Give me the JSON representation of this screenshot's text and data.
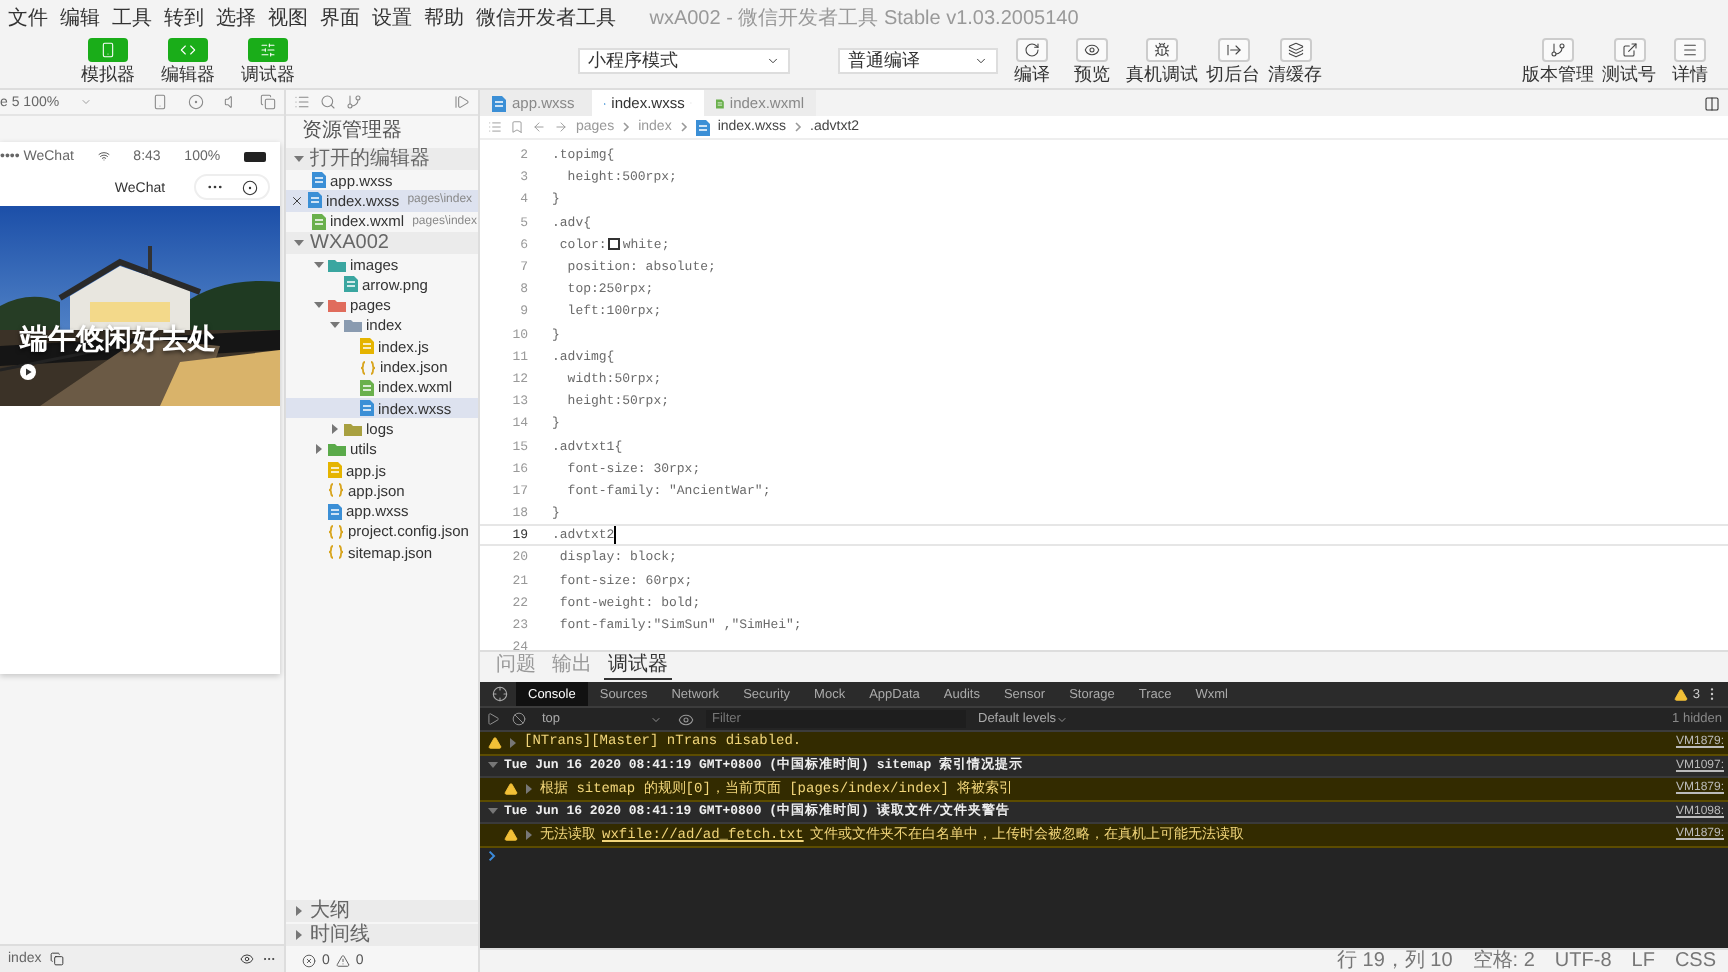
{
  "window": {
    "title": "wxA002 - 微信开发者工具 Stable v1.03.2005140"
  },
  "menu": [
    "文件",
    "编辑",
    "工具",
    "转到",
    "选择",
    "视图",
    "界面",
    "设置",
    "帮助",
    "微信开发者工具"
  ],
  "toolbar": {
    "views": [
      {
        "label": "模拟器",
        "kind": "phone",
        "on": true
      },
      {
        "label": "编辑器",
        "kind": "code",
        "on": true
      },
      {
        "label": "调试器",
        "kind": "debug",
        "on": true
      }
    ],
    "mode": "小程序模式",
    "compile": "普通编译",
    "actions": [
      {
        "label": "编译",
        "kind": "refresh"
      },
      {
        "label": "预览",
        "kind": "eye"
      },
      {
        "label": "真机调试",
        "kind": "bug"
      },
      {
        "label": "切后台",
        "kind": "switch"
      },
      {
        "label": "清缓存",
        "kind": "layers"
      }
    ],
    "right": [
      {
        "label": "版本管理",
        "kind": "branch"
      },
      {
        "label": "测试号",
        "kind": "external"
      },
      {
        "label": "详情",
        "kind": "menu"
      }
    ]
  },
  "simulator": {
    "zoom": "e 5 100%",
    "carrier": "•••• WeChat",
    "time": "8:43",
    "battery": "100%",
    "nav_title": "WeChat",
    "banner": {
      "kind": "picture",
      "title": "端午悠闲好去处"
    },
    "page_path": "index"
  },
  "explorer": {
    "title": "资源管理器",
    "open_editors": {
      "label": "打开的编辑器",
      "expanded": true,
      "items": [
        {
          "name": "app.wxss",
          "kind": "css",
          "selected": false
        },
        {
          "name": "index.wxss",
          "path": "pages\\index",
          "kind": "css",
          "selected": true
        },
        {
          "name": "index.wxml",
          "path": "pages\\index",
          "kind": "wxml",
          "selected": false
        }
      ]
    },
    "project": {
      "label": "WXA002",
      "expanded": true
    },
    "tree": [
      {
        "name": "images",
        "kind": "folder",
        "color": "#3aa6a0",
        "expanded": true,
        "selected": false,
        "children": [
          {
            "name": "arrow.png",
            "selected": false
          }
        ]
      },
      {
        "name": "pages",
        "kind": "folder",
        "color": "#e06c5c",
        "expanded": true,
        "selected": false,
        "children": [
          {
            "name": "index",
            "kind": "folder",
            "color": "#8a9bb0",
            "expanded": true,
            "selected": false,
            "children": [
              {
                "name": "index.js",
                "kind": "js",
                "selected": false
              },
              {
                "name": "index.json",
                "kind": "json",
                "selected": false
              },
              {
                "name": "index.wxml",
                "kind": "wxml",
                "selected": false
              },
              {
                "name": "index.wxss",
                "kind": "css",
                "selected": true
              }
            ]
          },
          {
            "name": "logs",
            "kind": "folder",
            "color": "#a8a040",
            "expanded": false,
            "selected": false
          }
        ]
      },
      {
        "name": "utils",
        "kind": "folder",
        "color": "#5aaa4a",
        "expanded": false,
        "selected": false
      },
      {
        "name": "app.js",
        "kind": "js",
        "selected": false
      },
      {
        "name": "app.json",
        "kind": "json",
        "selected": false
      },
      {
        "name": "app.wxss",
        "kind": "css",
        "selected": false
      },
      {
        "name": "project.config.json",
        "kind": "json",
        "selected": false
      },
      {
        "name": "sitemap.json",
        "kind": "json",
        "selected": false
      }
    ],
    "sections": [
      {
        "label": "大纲",
        "expanded": false
      },
      {
        "label": "时间线",
        "expanded": false
      }
    ],
    "problems": {
      "errors": "0",
      "warnings": "0"
    }
  },
  "editor": {
    "tabs": [
      {
        "name": "app.wxss",
        "kind": "css",
        "selected": false
      },
      {
        "name": "index.wxss",
        "kind": "css",
        "selected": true
      },
      {
        "name": "index.wxml",
        "kind": "wxml",
        "selected": false
      }
    ],
    "breadcrumb": [
      "pages",
      "index",
      "index.wxss",
      ".advtxt2"
    ],
    "lines": [
      {
        "number": "2",
        "text": ".topimg{",
        "current": false
      },
      {
        "number": "3",
        "text": "  height:500rpx;",
        "current": false
      },
      {
        "number": "4",
        "text": "}",
        "current": false
      },
      {
        "number": "5",
        "text": ".adv{",
        "current": false
      },
      {
        "number": "6",
        "text": " color:",
        "color": "#ffffff",
        "after": "white;",
        "current": false
      },
      {
        "number": "7",
        "text": "  position: absolute;",
        "current": false
      },
      {
        "number": "8",
        "text": "  top:250rpx;",
        "current": false
      },
      {
        "number": "9",
        "text": "  left:100rpx;",
        "current": false
      },
      {
        "number": "10",
        "text": "}",
        "current": false
      },
      {
        "number": "11",
        "text": ".advimg{",
        "current": false
      },
      {
        "number": "12",
        "text": "  width:50rpx;",
        "current": false
      },
      {
        "number": "13",
        "text": "  height:50rpx;",
        "current": false
      },
      {
        "number": "14",
        "text": "}",
        "current": false
      },
      {
        "number": "15",
        "text": ".advtxt1{",
        "current": false
      },
      {
        "number": "16",
        "text": "  font-size: 30rpx;",
        "current": false
      },
      {
        "number": "17",
        "text": "  font-family: \"AncientWar\";",
        "current": false
      },
      {
        "number": "18",
        "text": "}",
        "current": false
      },
      {
        "number": "19",
        "text": ".advtxt2",
        "current": true
      },
      {
        "number": "20",
        "text": " display: block;",
        "current": false
      },
      {
        "number": "21",
        "text": " font-size: 60rpx;",
        "current": false
      },
      {
        "number": "22",
        "text": " font-weight: bold;",
        "current": false
      },
      {
        "number": "23",
        "text": " font-family:\"SimSun\" ,\"SimHei\";",
        "current": false
      },
      {
        "number": "24",
        "current": false
      }
    ]
  },
  "panel": {
    "tabs": [
      {
        "label": "问题",
        "selected": false
      },
      {
        "label": "输出",
        "selected": false
      },
      {
        "label": "调试器",
        "selected": true
      }
    ],
    "devtools": {
      "tabs": [
        {
          "label": "Console",
          "selected": true
        },
        {
          "label": "Sources",
          "selected": false
        },
        {
          "label": "Network",
          "selected": false
        },
        {
          "label": "Security",
          "selected": false
        },
        {
          "label": "Mock",
          "selected": false
        },
        {
          "label": "AppData",
          "selected": false
        },
        {
          "label": "Audits",
          "selected": false
        },
        {
          "label": "Sensor",
          "selected": false
        },
        {
          "label": "Storage",
          "selected": false
        },
        {
          "label": "Trace",
          "selected": false
        },
        {
          "label": "Wxml",
          "selected": false
        }
      ],
      "warning_count": "3",
      "context": "top",
      "filter_placeholder": "Filter",
      "levels": "Default levels",
      "hidden": "1 hidden",
      "messages": [
        {
          "kind": "warn",
          "expanded": false,
          "text": "[NTrans][Master] nTrans disabled.",
          "source": "VM1879:"
        },
        {
          "kind": "group",
          "expanded": true,
          "text": "Tue Jun 16 2020 08:41:19 GMT+0800 (中国标准时间) sitemap 索引情况提示",
          "source": "VM1097:",
          "children": [
            {
              "kind": "warn",
              "expanded": false,
              "text": "根据 sitemap 的规则[0]，当前页面 [pages/index/index] 将被索引",
              "source": "VM1879:"
            }
          ]
        },
        {
          "kind": "group",
          "expanded": true,
          "text": "Tue Jun 16 2020 08:41:19 GMT+0800 (中国标准时间) 读取文件/文件夹警告",
          "source": "VM1098:",
          "children": [
            {
              "kind": "warn",
              "expanded": false,
              "text": "无法读取",
              "link": "wxfile://ad/ad_fetch.txt",
              "after": "文件或文件夹不在白名单中，上传时会被忽略，在真机上可能无法读取",
              "source": "VM1879:"
            }
          ]
        }
      ]
    }
  },
  "status_bar": [
    "行 19，列 10",
    "空格: 2",
    "UTF-8",
    "LF",
    "CSS"
  ]
}
